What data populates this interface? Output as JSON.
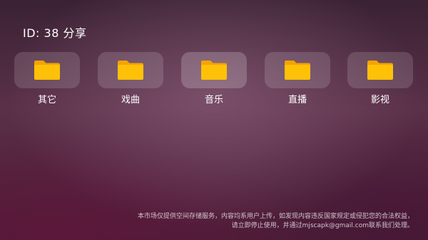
{
  "header": {
    "title": "ID: 38 分享"
  },
  "folders": [
    {
      "label": "其它",
      "icon": "folder-icon"
    },
    {
      "label": "戏曲",
      "icon": "folder-icon"
    },
    {
      "label": "音乐",
      "icon": "folder-icon"
    },
    {
      "label": "直播",
      "icon": "folder-icon"
    },
    {
      "label": "影视",
      "icon": "folder-icon"
    }
  ],
  "footer": {
    "line1": "本市场仅提供空间存储服务，内容均系用户上传，如发现内容违反国家规定或侵犯您的合法权益，",
    "line2": "请立即停止使用，并通过mjscapk@gmail.com联系我们处理。"
  },
  "colors": {
    "folder_body": "#FFC107",
    "folder_tab": "#F5A300",
    "tile_background": "rgba(255,255,255,0.14)"
  }
}
